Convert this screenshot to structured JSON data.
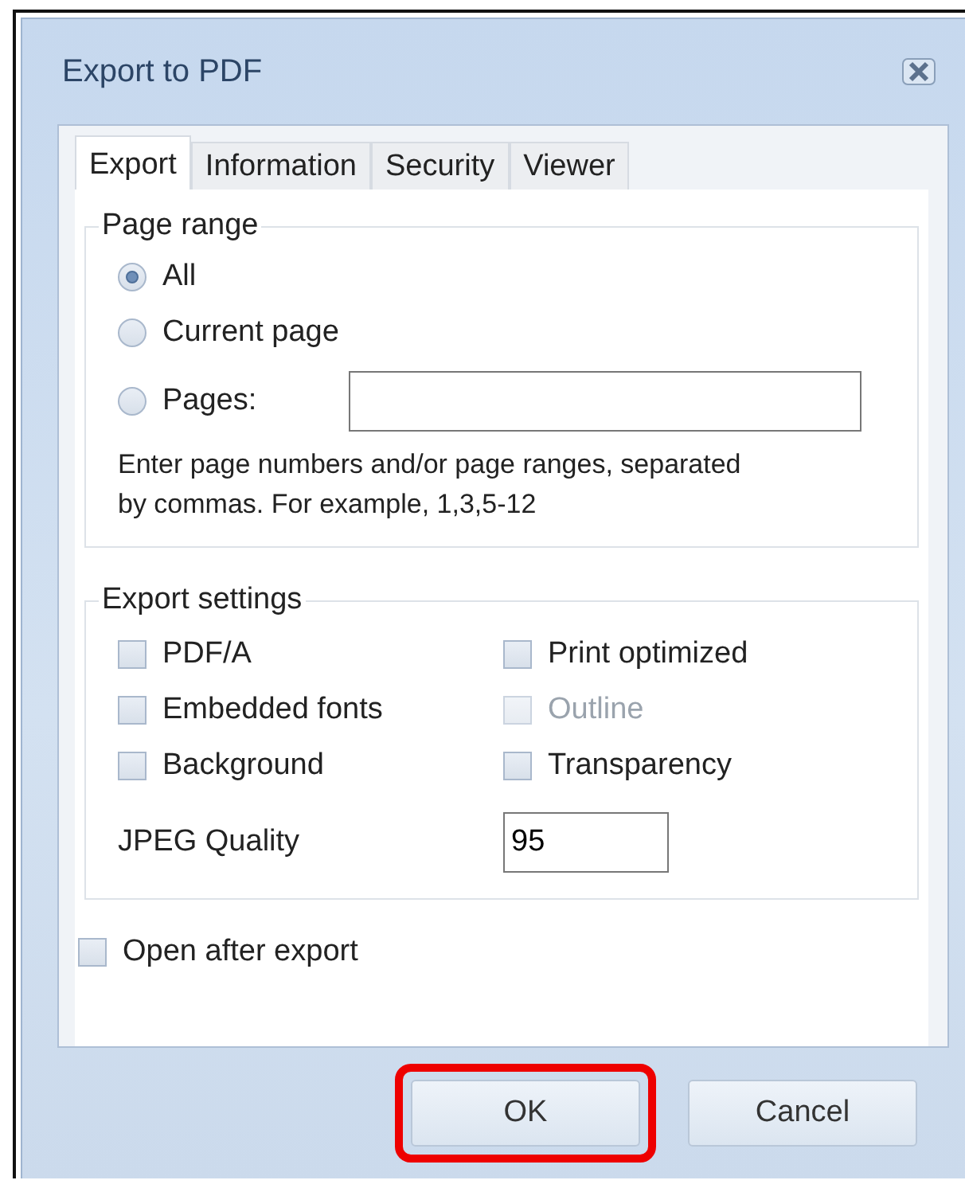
{
  "window": {
    "title": "Export to PDF"
  },
  "tabs": [
    {
      "label": "Export",
      "selected": true
    },
    {
      "label": "Information",
      "selected": false
    },
    {
      "label": "Security",
      "selected": false
    },
    {
      "label": "Viewer",
      "selected": false
    }
  ],
  "page_range": {
    "title": "Page range",
    "options": [
      {
        "label": "All",
        "selected": true
      },
      {
        "label": "Current page",
        "selected": false
      },
      {
        "label": "Pages:",
        "selected": false
      }
    ],
    "hint": "Enter page numbers and/or page ranges, separated by commas. For example, 1,3,5-12"
  },
  "export_settings": {
    "title": "Export settings",
    "checkboxes": [
      {
        "label": "PDF/A",
        "checked": false,
        "disabled": false
      },
      {
        "label": "Print optimized",
        "checked": false,
        "disabled": false
      },
      {
        "label": "Embedded fonts",
        "checked": false,
        "disabled": false
      },
      {
        "label": "Outline",
        "checked": false,
        "disabled": true
      },
      {
        "label": "Background",
        "checked": false,
        "disabled": false
      },
      {
        "label": "Transparency",
        "checked": false,
        "disabled": false
      }
    ],
    "jpeg_quality": {
      "label": "JPEG Quality",
      "value": "95"
    }
  },
  "open_after_export": {
    "label": "Open after export",
    "checked": false
  },
  "buttons": [
    {
      "label": "OK",
      "highlighted": true
    },
    {
      "label": "Cancel",
      "highlighted": false
    }
  ]
}
